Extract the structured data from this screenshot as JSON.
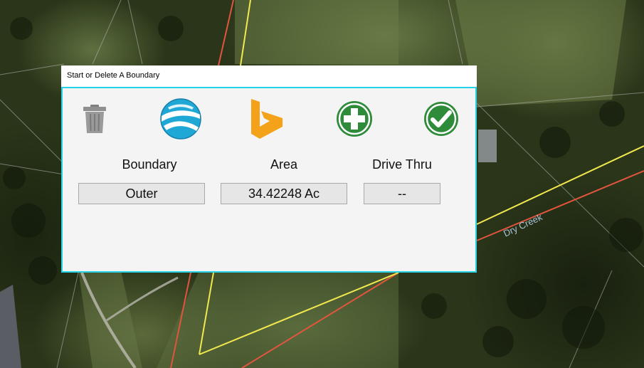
{
  "dialog": {
    "title": "Start or Delete A Boundary",
    "border_color": "#26d3e6"
  },
  "toolbar": [
    {
      "name": "delete-boundary",
      "icon": "trash-icon",
      "color": "#8c8c8c"
    },
    {
      "name": "google-earth",
      "icon": "google-earth-icon",
      "color": "#1fa7d6"
    },
    {
      "name": "bing-maps",
      "icon": "bing-icon",
      "color": "#f5a21b"
    },
    {
      "name": "add-boundary",
      "icon": "plus-circle-icon",
      "color": "#2e8b3a"
    },
    {
      "name": "confirm",
      "icon": "checkmark-circle-icon",
      "color": "#2e8b3a"
    }
  ],
  "fields": {
    "boundary": {
      "label": "Boundary",
      "value": "Outer"
    },
    "area": {
      "label": "Area",
      "value": "34.42248 Ac"
    },
    "drive_thru": {
      "label": "Drive Thru",
      "value": "--"
    }
  },
  "map": {
    "label": "Dry Creek",
    "boundary_line_color": "#f2e94e",
    "parcel_line_color": "#e0553e",
    "grid_line_color": "#b9b9b9"
  }
}
